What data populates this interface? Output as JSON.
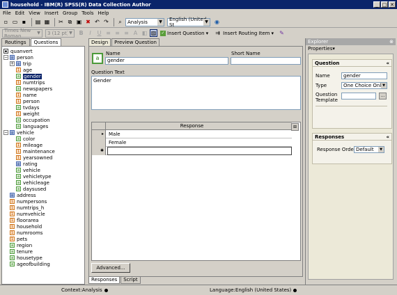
{
  "window": {
    "title": "household - IBM(R) SPSS(R) Data Collection Author"
  },
  "window_controls": {
    "minimize": "_",
    "maximize": "□",
    "close": "✕"
  },
  "menu": [
    "File",
    "Edit",
    "View",
    "Insert",
    "Group",
    "Tools",
    "Help"
  ],
  "toolbar": {
    "context_combo": "Analysis",
    "language_combo": "English (United St",
    "font_combo": "Times New Roman",
    "size_combo": "3 (12 pt)",
    "bold": "B",
    "italic": "I",
    "underline": "U",
    "insert_question": "Insert Question",
    "insert_routing": "Insert Routing Item"
  },
  "left_tabs": [
    "Routings",
    "Questions"
  ],
  "tree": [
    {
      "label": "quanvert",
      "icon": "root-icon",
      "type": "root",
      "level": 0
    },
    {
      "label": "person",
      "icon": "grid-icon",
      "type": "grp",
      "level": 1,
      "expander": "−"
    },
    {
      "label": "trip",
      "icon": "grid-icon",
      "type": "grp",
      "level": 2,
      "expander": "+"
    },
    {
      "label": "age",
      "icon": "numeric-icon",
      "type": "num",
      "level": 2
    },
    {
      "label": "gender",
      "icon": "category-icon",
      "type": "txt",
      "level": 2,
      "selected": true
    },
    {
      "label": "numtrips",
      "icon": "numeric-icon",
      "type": "num",
      "level": 2
    },
    {
      "label": "newspapers",
      "icon": "category-icon",
      "type": "txt",
      "level": 2
    },
    {
      "label": "name",
      "icon": "text-icon",
      "type": "num",
      "level": 2
    },
    {
      "label": "person",
      "icon": "numeric-icon",
      "type": "num",
      "level": 2
    },
    {
      "label": "tvdays",
      "icon": "category-icon",
      "type": "txt",
      "level": 2
    },
    {
      "label": "weight",
      "icon": "numeric-icon",
      "type": "num",
      "level": 2
    },
    {
      "label": "occupation",
      "icon": "category-icon",
      "type": "txt",
      "level": 2
    },
    {
      "label": "languages",
      "icon": "category-icon",
      "type": "txt",
      "level": 2
    },
    {
      "label": "vehicle",
      "icon": "grid-icon",
      "type": "grp",
      "level": 1,
      "expander": "−"
    },
    {
      "label": "color",
      "icon": "category-icon",
      "type": "txt",
      "level": 2
    },
    {
      "label": "mileage",
      "icon": "numeric-icon",
      "type": "num",
      "level": 2
    },
    {
      "label": "maintenance",
      "icon": "numeric-icon",
      "type": "num",
      "level": 2
    },
    {
      "label": "yearsowned",
      "icon": "numeric-icon",
      "type": "num",
      "level": 2
    },
    {
      "label": "rating",
      "icon": "grid-icon",
      "type": "grp",
      "level": 2
    },
    {
      "label": "vehicle",
      "icon": "category-icon",
      "type": "txt",
      "level": 2
    },
    {
      "label": "vehicletype",
      "icon": "category-icon",
      "type": "txt",
      "level": 2
    },
    {
      "label": "vehicleage",
      "icon": "category-icon",
      "type": "txt",
      "level": 2
    },
    {
      "label": "daysused",
      "icon": "category-icon",
      "type": "txt",
      "level": 2
    },
    {
      "label": "address",
      "icon": "text-icon",
      "type": "grp",
      "level": 1
    },
    {
      "label": "numpersons",
      "icon": "numeric-icon",
      "type": "num",
      "level": 1
    },
    {
      "label": "numtrips_h",
      "icon": "numeric-icon",
      "type": "num",
      "level": 1
    },
    {
      "label": "numvehicle",
      "icon": "numeric-icon",
      "type": "num",
      "level": 1
    },
    {
      "label": "floorarea",
      "icon": "numeric-icon",
      "type": "num",
      "level": 1
    },
    {
      "label": "household",
      "icon": "numeric-icon",
      "type": "num",
      "level": 1
    },
    {
      "label": "numrooms",
      "icon": "numeric-icon",
      "type": "num",
      "level": 1
    },
    {
      "label": "pets",
      "icon": "numeric-icon",
      "type": "num",
      "level": 1
    },
    {
      "label": "region",
      "icon": "category-icon",
      "type": "txt",
      "level": 1
    },
    {
      "label": "tenure",
      "icon": "category-icon",
      "type": "txt",
      "level": 1
    },
    {
      "label": "housetype",
      "icon": "category-icon",
      "type": "txt",
      "level": 1
    },
    {
      "label": "ageofbuilding",
      "icon": "category-icon",
      "type": "txt",
      "level": 1
    }
  ],
  "center": {
    "tabs": [
      "Design",
      "Preview Question"
    ],
    "bottom_tabs": [
      "Responses",
      "Script"
    ],
    "name_label": "Name",
    "name_value": "gender",
    "short_name_label": "Short Name",
    "short_name_value": "",
    "question_text_label": "Question Text",
    "question_text": "Gender",
    "grid_header": "Response",
    "responses": [
      "Male",
      "Female"
    ],
    "row_markers": [
      "▸",
      "",
      "✱"
    ],
    "advanced_button": "Advanced..."
  },
  "explorer": {
    "title": "Explorer",
    "properties_label": "Properties▾",
    "question_section": "Question",
    "name_label": "Name",
    "name_value": "gender",
    "type_label": "Type",
    "type_value": "One Choice Only",
    "template_label": "Question Template",
    "template_value": "",
    "template_button": "...",
    "responses_section": "Responses",
    "response_order_label": "Response Order",
    "response_order_value": "Default",
    "collapse_glyph": "«"
  },
  "status": {
    "context": "Context:Analysis",
    "language": "Language:English (United States)"
  }
}
